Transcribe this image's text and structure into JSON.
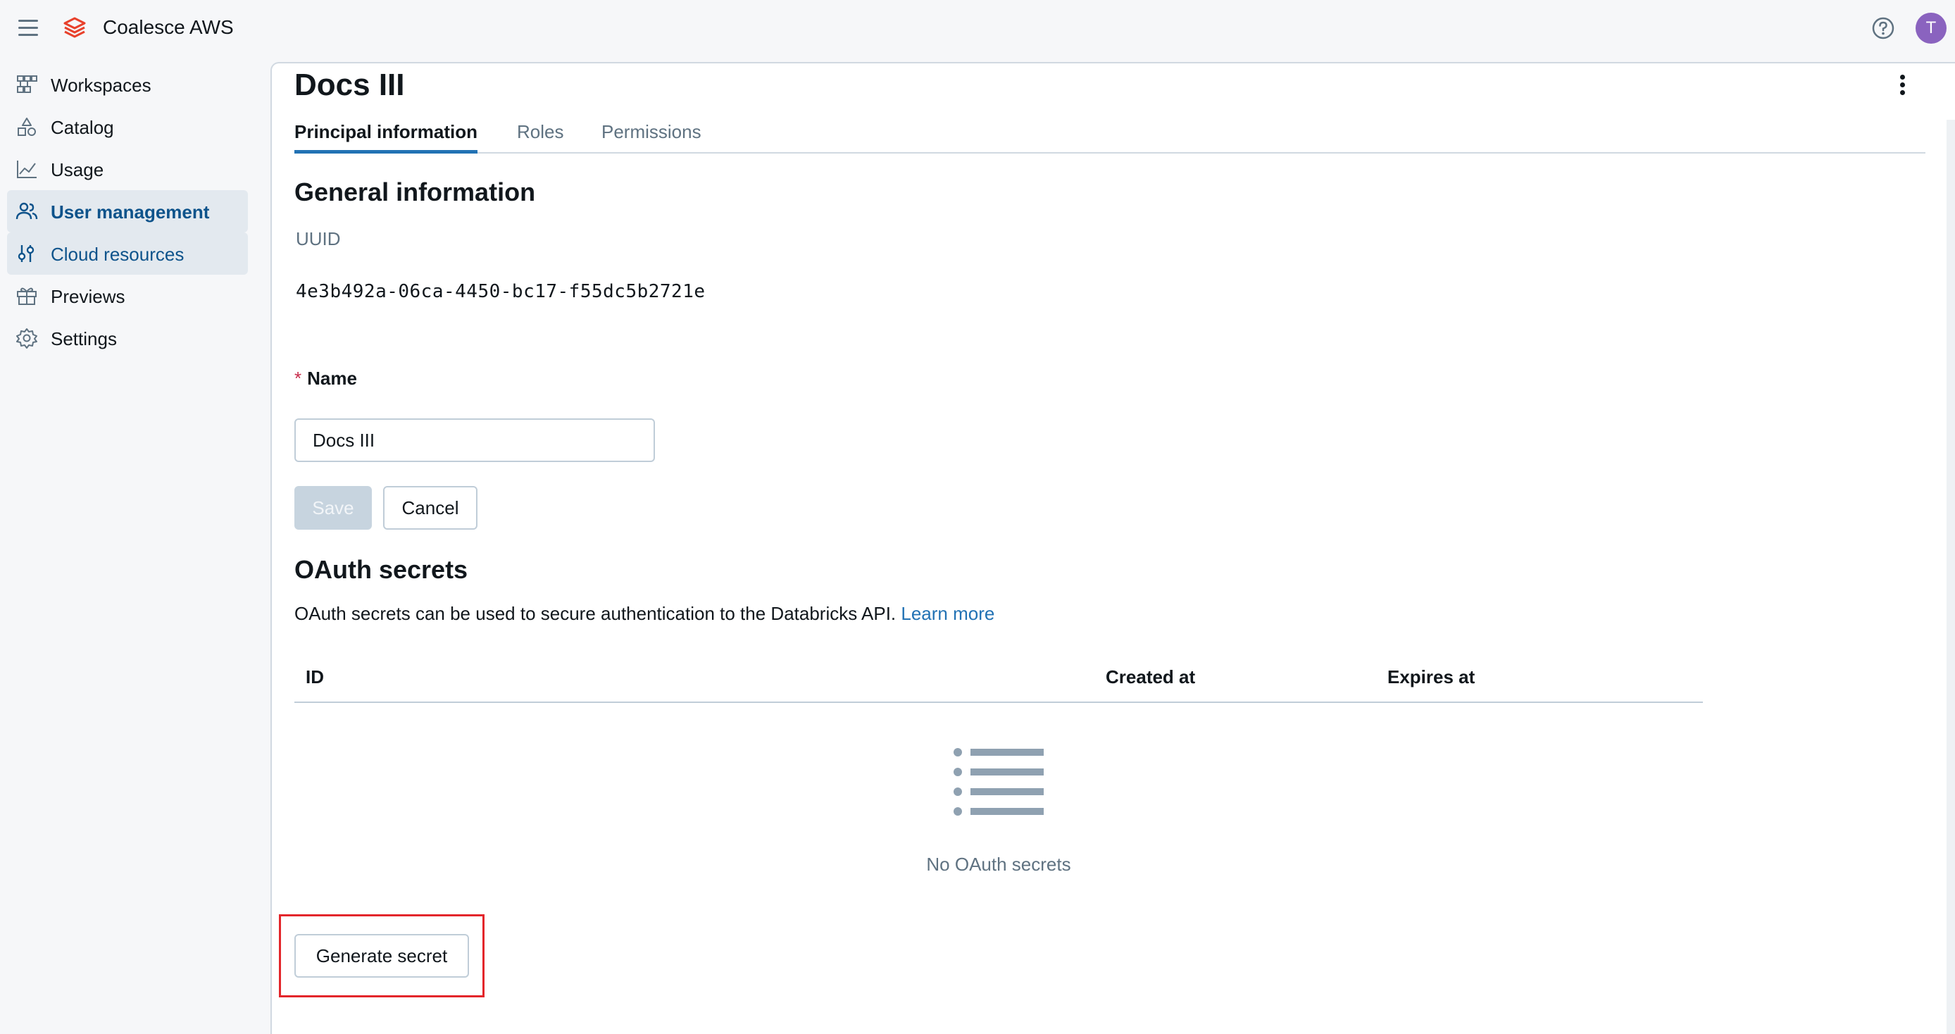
{
  "app": {
    "title": "Coalesce AWS",
    "avatar_initial": "T"
  },
  "sidebar": {
    "items": [
      {
        "label": "Workspaces",
        "icon": "workspaces-icon"
      },
      {
        "label": "Catalog",
        "icon": "catalog-icon"
      },
      {
        "label": "Usage",
        "icon": "usage-chart-icon"
      },
      {
        "label": "User management",
        "icon": "users-icon"
      },
      {
        "label": "Cloud resources",
        "icon": "cloud-resources-icon"
      },
      {
        "label": "Previews",
        "icon": "gift-icon"
      },
      {
        "label": "Settings",
        "icon": "gear-icon"
      }
    ]
  },
  "page": {
    "title": "Docs III",
    "tabs": [
      {
        "label": "Principal information"
      },
      {
        "label": "Roles"
      },
      {
        "label": "Permissions"
      }
    ]
  },
  "general": {
    "heading": "General information",
    "uuid_label": "UUID",
    "uuid_value": "4e3b492a-06ca-4450-bc17-f55dc5b2721e",
    "name_required_mark": "*",
    "name_label": "Name",
    "name_value": "Docs III",
    "save_label": "Save",
    "cancel_label": "Cancel"
  },
  "oauth": {
    "heading": "OAuth secrets",
    "description": "OAuth secrets can be used to secure authentication to the Databricks API.",
    "learn_more": "Learn more",
    "columns": [
      "ID",
      "Created at",
      "Expires at"
    ],
    "rows": [],
    "empty_text": "No OAuth secrets",
    "generate_label": "Generate secret"
  },
  "colors": {
    "accent": "#2272b4",
    "active_nav_text": "#0e538b",
    "highlight_box": "#e3262b",
    "avatar_bg": "#8a63bf",
    "logo": "#e8412c"
  }
}
